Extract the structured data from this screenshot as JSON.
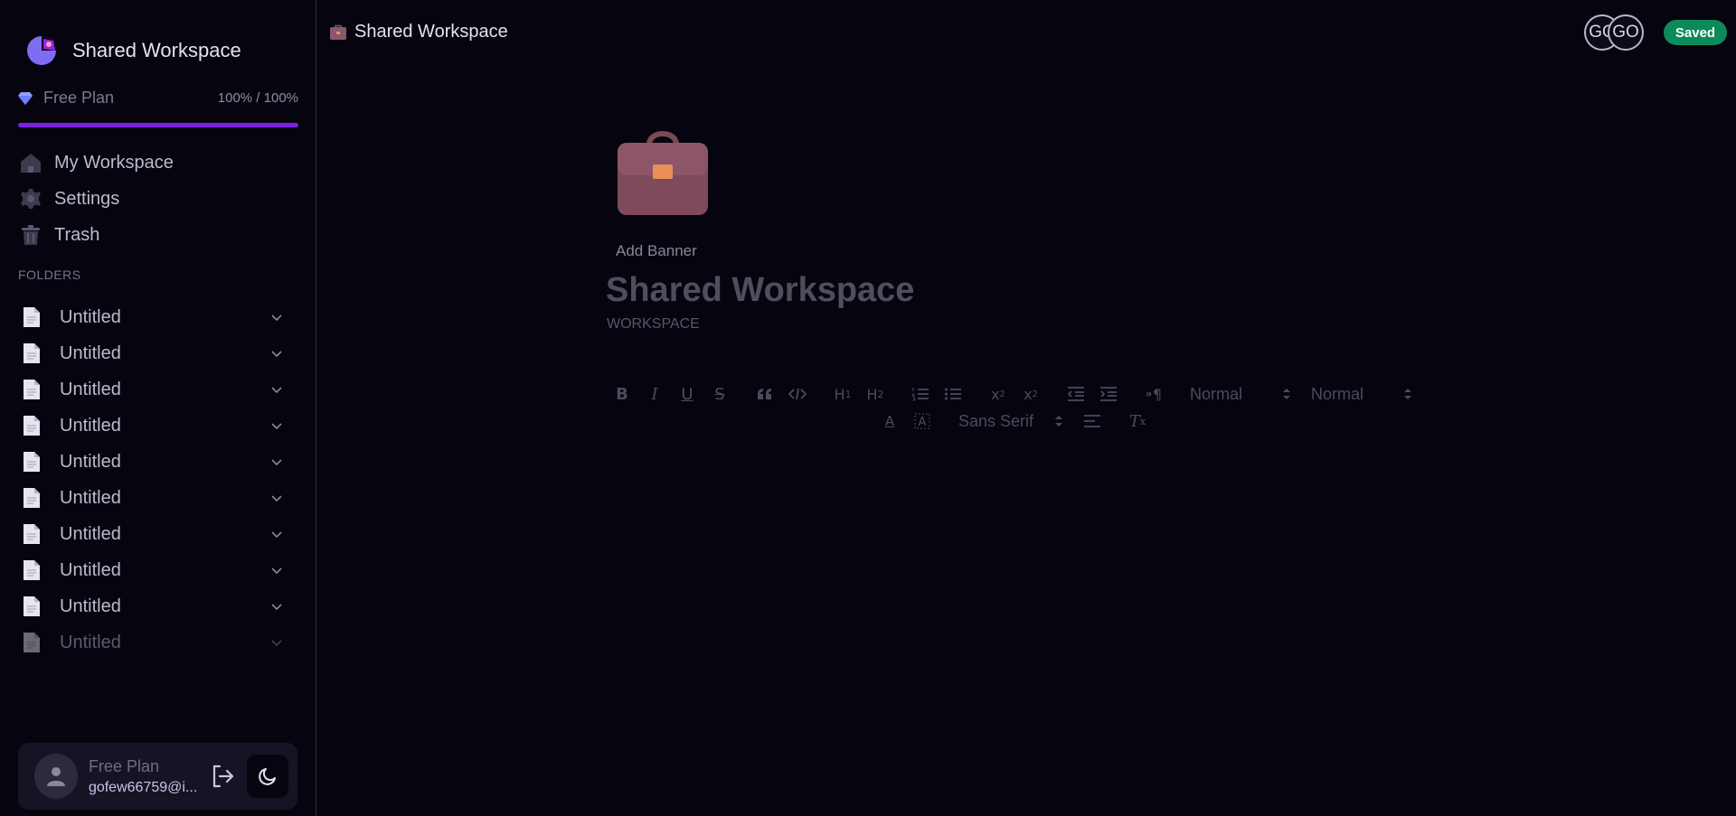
{
  "sidebar": {
    "workspace_name": "Shared Workspace",
    "plan_label": "Free Plan",
    "plan_usage": "100% / 100%",
    "plan_progress_percent": 100,
    "nav": [
      {
        "label": "My Workspace",
        "icon": "home-icon"
      },
      {
        "label": "Settings",
        "icon": "gear-icon"
      },
      {
        "label": "Trash",
        "icon": "trash-icon"
      }
    ],
    "folders_title": "FOLDERS",
    "folders": [
      "Untitled",
      "Untitled",
      "Untitled",
      "Untitled",
      "Untitled",
      "Untitled",
      "Untitled",
      "Untitled",
      "Untitled",
      "Untitled"
    ],
    "user": {
      "plan": "Free Plan",
      "email": "gofew66759@i..."
    }
  },
  "header": {
    "breadcrumb_icon": "briefcase-icon",
    "breadcrumb_title": "Shared Workspace",
    "collaborators": [
      "GO",
      "GO"
    ],
    "status": "Saved"
  },
  "document": {
    "icon": "briefcase-icon",
    "add_banner": "Add Banner",
    "title": "Shared Workspace",
    "subtitle": "WORKSPACE"
  },
  "toolbar": {
    "header_select": "Normal",
    "size_select": "Normal",
    "font_select": "Sans Serif"
  },
  "colors": {
    "background": "#06040f",
    "accent": "#7b1fe3",
    "saved": "#0d8a5a"
  }
}
